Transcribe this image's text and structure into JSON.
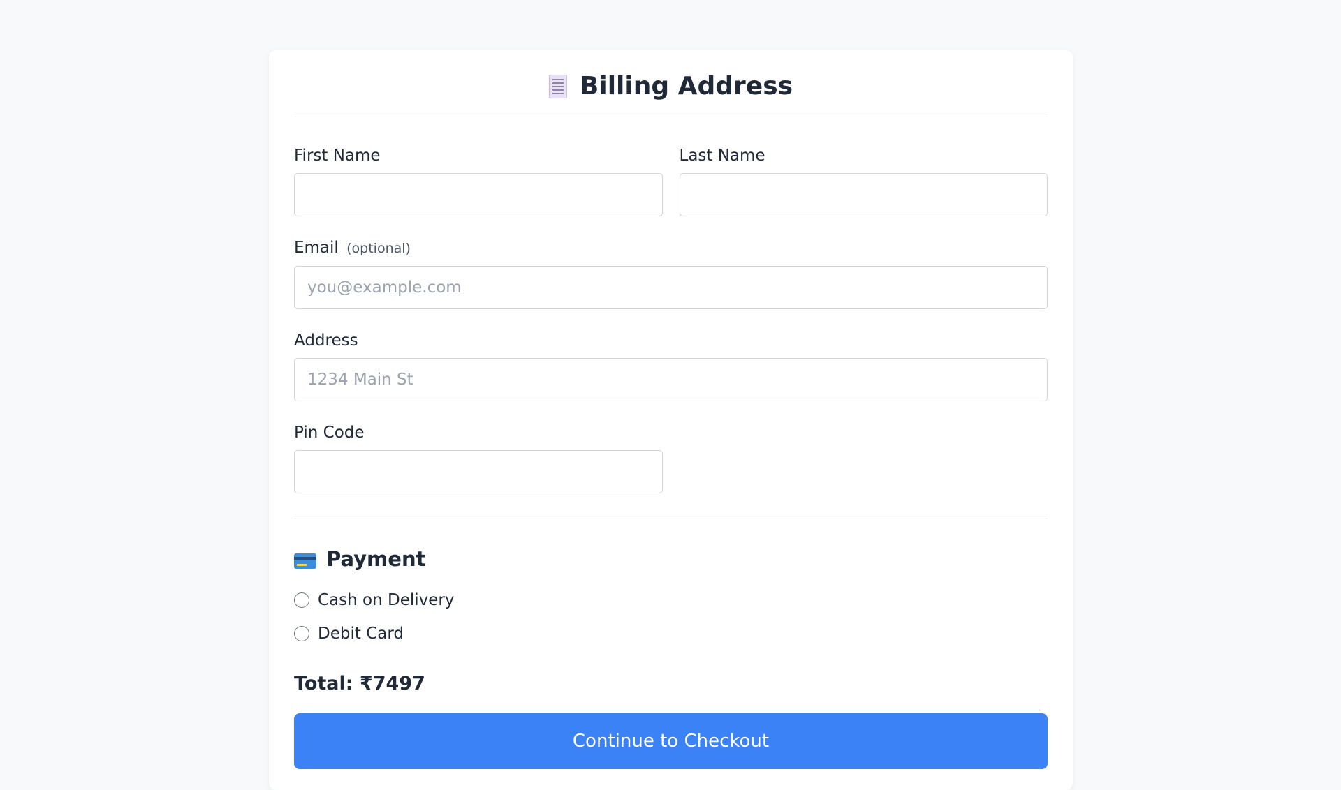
{
  "header": {
    "title": "Billing Address",
    "icon": "receipt-icon"
  },
  "form": {
    "first_name": {
      "label": "First Name",
      "value": "",
      "placeholder": ""
    },
    "last_name": {
      "label": "Last Name",
      "value": "",
      "placeholder": ""
    },
    "email": {
      "label": "Email",
      "optional_note": "(optional)",
      "value": "",
      "placeholder": "you@example.com"
    },
    "address": {
      "label": "Address",
      "value": "",
      "placeholder": "1234 Main St"
    },
    "pin_code": {
      "label": "Pin Code",
      "value": "",
      "placeholder": ""
    }
  },
  "payment": {
    "title": "Payment",
    "icon": "credit-card-icon",
    "options": [
      {
        "label": "Cash on Delivery",
        "selected": false
      },
      {
        "label": "Debit Card",
        "selected": false
      }
    ]
  },
  "summary": {
    "total_text": "Total: ₹7497"
  },
  "actions": {
    "checkout_label": "Continue to Checkout"
  },
  "colors": {
    "accent": "#3b82f6",
    "background": "#f8f9fb"
  }
}
